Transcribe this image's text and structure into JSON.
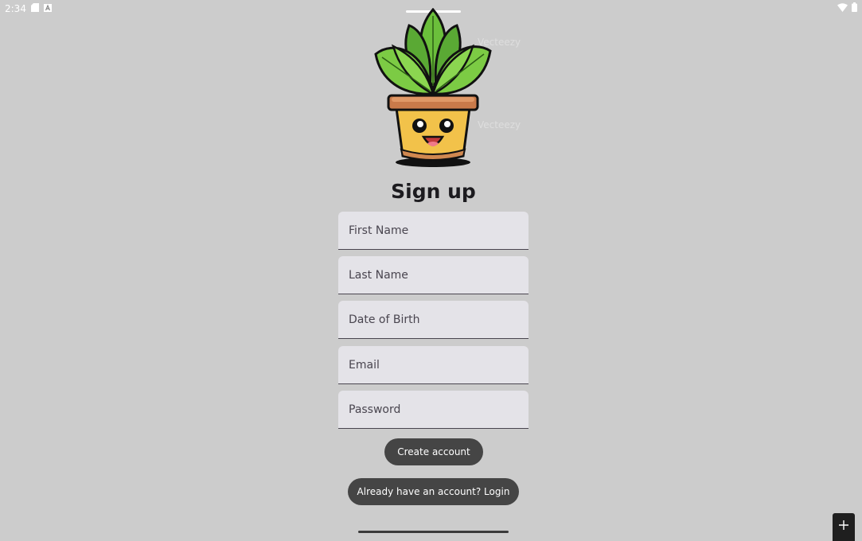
{
  "status_bar": {
    "time": "2:34",
    "icons_left": [
      "sd-card-icon",
      "font-icon"
    ],
    "icons_right": [
      "wifi-icon",
      "battery-icon"
    ]
  },
  "watermark": "Vecteezy",
  "page": {
    "title": "Sign up"
  },
  "form": {
    "first_name": {
      "value": "",
      "placeholder": "First Name"
    },
    "last_name": {
      "value": "",
      "placeholder": "Last Name"
    },
    "dob": {
      "value": "",
      "placeholder": "Date of Birth"
    },
    "email": {
      "value": "",
      "placeholder": "Email"
    },
    "password": {
      "value": "",
      "placeholder": "Password"
    }
  },
  "buttons": {
    "create": "Create account",
    "login": "Already have an account? Login"
  },
  "fab": {
    "icon": "plus-icon"
  },
  "colors": {
    "background": "#cccccc",
    "field_bg": "#e4e3e8",
    "button_bg": "#454545",
    "leaf_green": "#6bbf3b",
    "pot_yellow": "#f2c24a",
    "pot_rim": "#c97a4a"
  }
}
